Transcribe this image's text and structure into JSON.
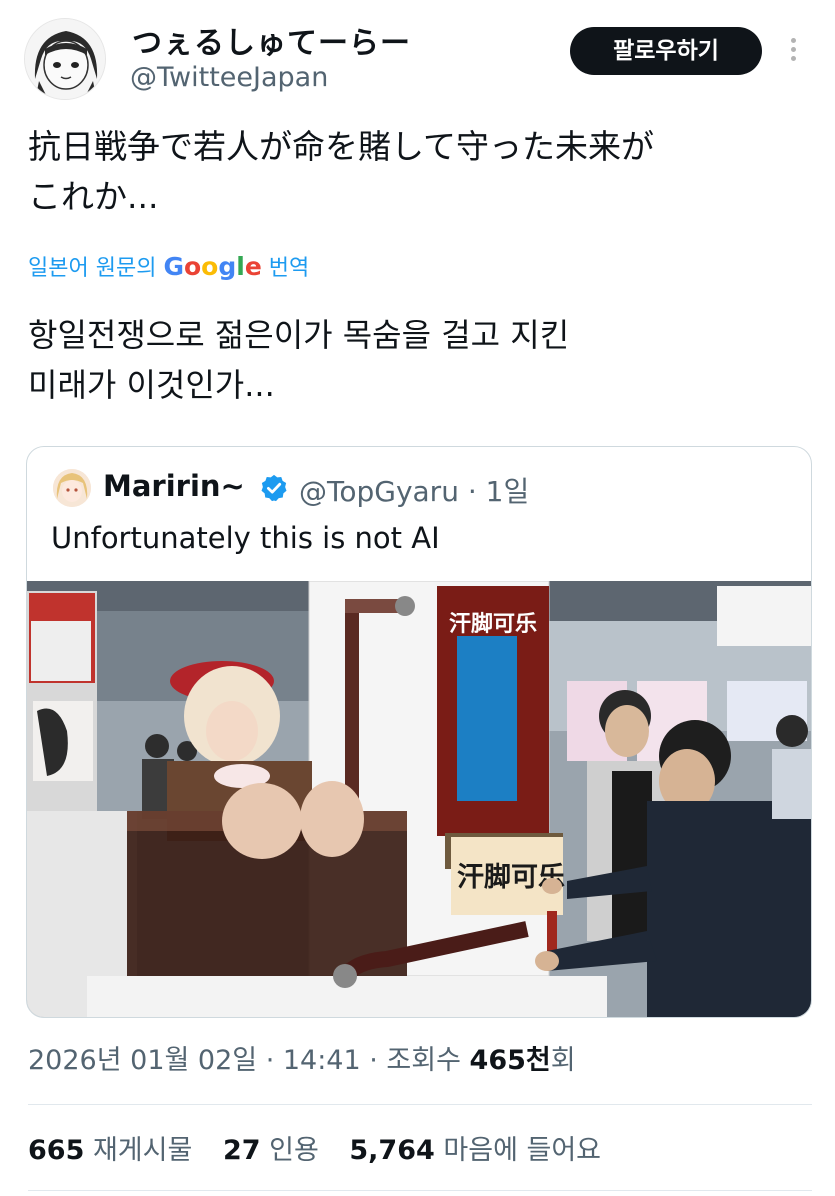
{
  "author": {
    "display_name": "つぇるしゅてーらー",
    "handle": "@TwitteeJapan",
    "follow_label": "팔로우하기"
  },
  "tweet": {
    "text_line1": "抗日戦争で若人が命を賭して守った未来が",
    "text_line2": "これか...",
    "translate_prefix": "일본어 원문의",
    "translate_google": "Google",
    "translate_suffix": "번역",
    "translated_line1": "항일전쟁으로 젊은이가 목숨을 걸고 지킨",
    "translated_line2": "미래가 이것인가..."
  },
  "quote": {
    "display_name": "Maririn~",
    "handle_time": "@TopGyaru · 1일",
    "text": "Unfortunately this is not AI",
    "sign_top": "汗脚可乐",
    "sign_bottom": "汗脚可乐"
  },
  "meta": {
    "date_time": "2026년 01월 02일 · 14:41 · 조회수",
    "views": "465천",
    "views_suffix": "회"
  },
  "stats": {
    "retweets": "665",
    "retweets_label": "재게시물",
    "quotes": "27",
    "quotes_label": "인용",
    "likes": "5,764",
    "likes_label": "마음에 들어요"
  },
  "colors": {
    "link_blue": "#1d9bf0",
    "secondary_text": "#536471",
    "follow_bg": "#0f1419",
    "verified_blue": "#1d9bf0"
  }
}
